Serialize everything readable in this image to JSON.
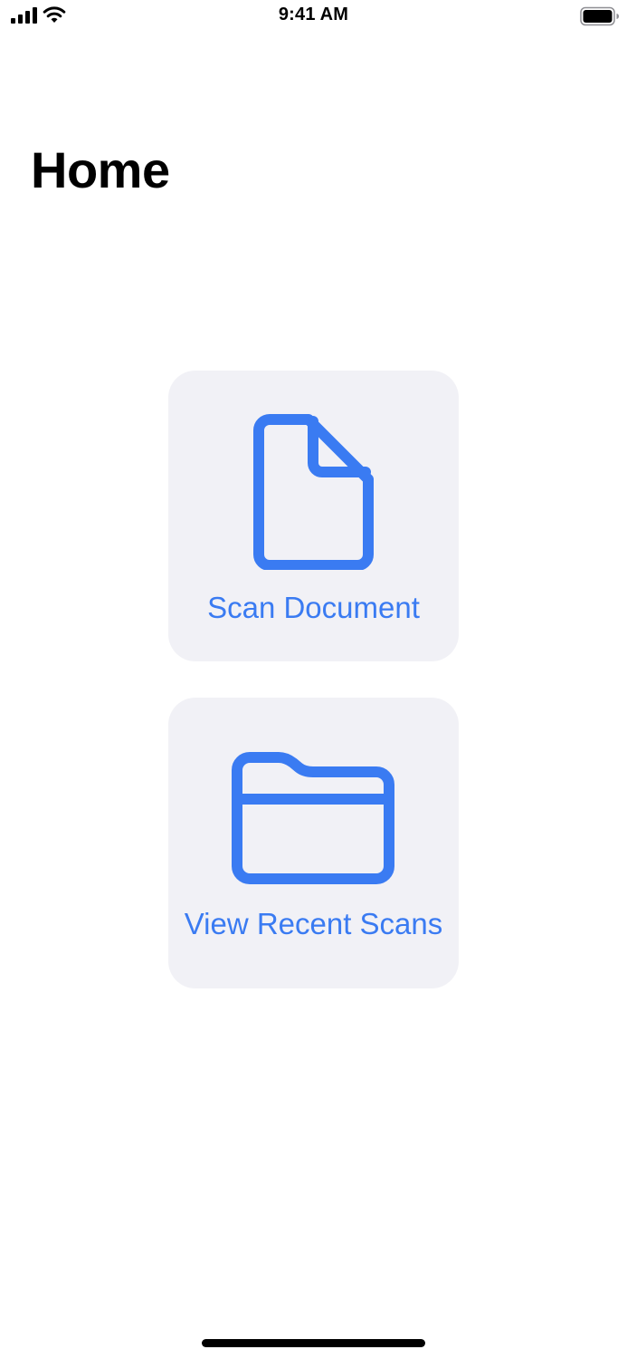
{
  "status_bar": {
    "time": "9:41 AM",
    "icons": [
      "signal-icon",
      "wifi-icon",
      "battery-icon"
    ]
  },
  "header": {
    "title": "Home"
  },
  "actions": [
    {
      "label": "Scan Document",
      "icon": "document-icon"
    },
    {
      "label": "View Recent Scans",
      "icon": "folder-icon"
    }
  ],
  "colors": {
    "accent": "#3a7bf2",
    "card_background": "#f1f1f6",
    "text": "#000000",
    "background": "#ffffff"
  }
}
